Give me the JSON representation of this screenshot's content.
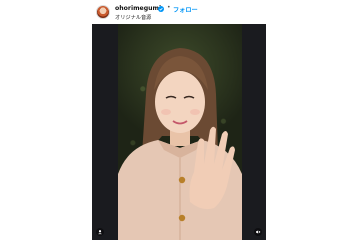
{
  "header": {
    "username": "ohorimegumi",
    "separator": "•",
    "follow_label": "フォロー",
    "audio_label": "オリジナル音源"
  },
  "icons": {
    "avatar": "profile-avatar",
    "verified": "verified-badge-icon",
    "profile": "user-icon",
    "mute": "speaker-muted-icon"
  },
  "colors": {
    "follow": "#0095f6",
    "verified": "#0095f6",
    "video_bg": "#1a1b1f"
  }
}
